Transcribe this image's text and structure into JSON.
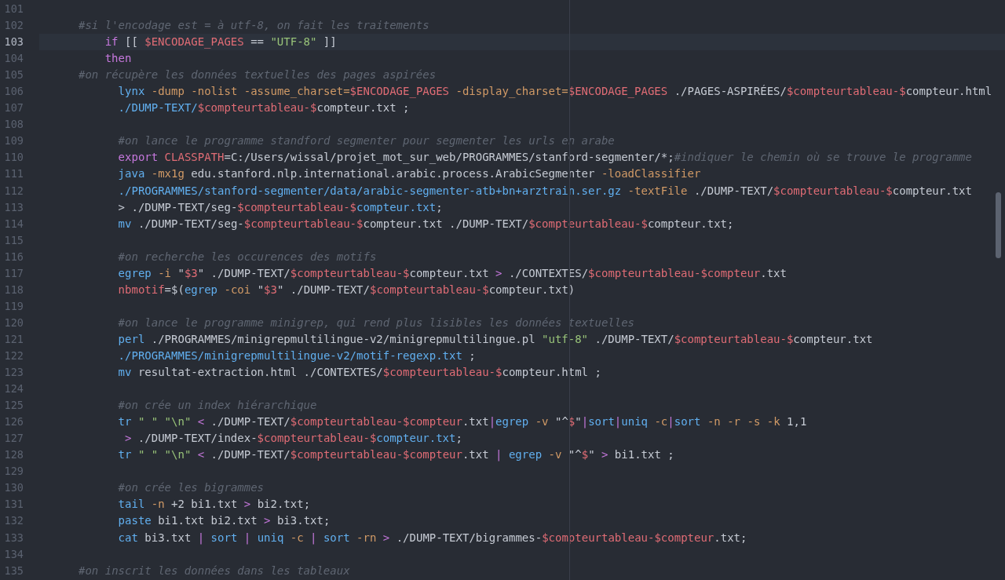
{
  "editor": {
    "lines": [
      {
        "number": "101",
        "current": false,
        "kind": "outer"
      },
      {
        "number": "102",
        "current": false,
        "kind": "outer",
        "tokens": [
          {
            "text": "#si l'encodage est = à utf-8, on fait les traitements",
            "kind": "comment"
          }
        ]
      },
      {
        "number": "103",
        "current": true,
        "kind": "inner",
        "tokens": [
          {
            "text": "if",
            "kind": "keyword"
          },
          {
            "text": " [[ ",
            "kind": "plain"
          },
          {
            "text": "$ENCODAGE_PAGES",
            "kind": "var"
          },
          {
            "text": " == ",
            "kind": "plain"
          },
          {
            "text": "\"UTF-8\"",
            "kind": "string"
          },
          {
            "text": " ]]",
            "kind": "plain"
          }
        ]
      },
      {
        "number": "104",
        "current": false,
        "kind": "inner",
        "tokens": [
          {
            "text": "then",
            "kind": "keyword"
          }
        ]
      },
      {
        "number": "105",
        "current": false,
        "kind": "outer",
        "tokens": [
          {
            "text": "#on récupère les données textuelles des pages aspirées",
            "kind": "comment"
          }
        ]
      },
      {
        "number": "106",
        "current": false,
        "kind": "body",
        "tokens": [
          {
            "text": "lynx",
            "kind": "func"
          },
          {
            "text": " -dump -nolist -assume_charset=",
            "kind": "option"
          },
          {
            "text": "$ENCODAGE_PAGES",
            "kind": "var"
          },
          {
            "text": " -display_charset=",
            "kind": "option"
          },
          {
            "text": "$ENCODAGE_PAGES",
            "kind": "var"
          },
          {
            "text": " ./PAGES-ASPIRÉES/",
            "kind": "plain"
          },
          {
            "text": "$compteurtableau-$",
            "kind": "var"
          },
          {
            "text": "compteur.html",
            "kind": "plain"
          }
        ]
      },
      {
        "number": "107",
        "current": false,
        "kind": "body",
        "tokens": [
          {
            "text": "./DUMP-TEXT/",
            "kind": "func"
          },
          {
            "text": "$compteurtableau-$",
            "kind": "var"
          },
          {
            "text": "compteur.txt ;",
            "kind": "plain"
          }
        ]
      },
      {
        "number": "108",
        "current": false,
        "kind": "outer"
      },
      {
        "number": "109",
        "current": false,
        "kind": "body",
        "tokens": [
          {
            "text": "#on lance le programme standford segmenter pour segmenter les urls en arabe",
            "kind": "comment"
          }
        ]
      },
      {
        "number": "110",
        "current": false,
        "kind": "body",
        "tokens": [
          {
            "text": "export",
            "kind": "keyword"
          },
          {
            "text": " CLASSPATH",
            "kind": "var"
          },
          {
            "text": "=C:/Users/wissal/projet_mot_sur_web/PROGRAMMES/stanford-segmenter/*;",
            "kind": "plain"
          },
          {
            "text": "#indiquer le chemin où se trouve le programme",
            "kind": "comment"
          }
        ]
      },
      {
        "number": "111",
        "current": false,
        "kind": "body",
        "tokens": [
          {
            "text": "java",
            "kind": "func"
          },
          {
            "text": " -mx1g",
            "kind": "option"
          },
          {
            "text": " edu.stanford.nlp.international.arabic.process.ArabicSegmenter ",
            "kind": "plain"
          },
          {
            "text": "-loadClassifier",
            "kind": "option"
          }
        ]
      },
      {
        "number": "112",
        "current": false,
        "kind": "body",
        "tokens": [
          {
            "text": "./PROGRAMMES/stanford-segmenter/data/arabic-segmenter-atb+bn+arztrain.ser.gz",
            "kind": "func"
          },
          {
            "text": " -textFile",
            "kind": "option"
          },
          {
            "text": " ./DUMP-TEXT/",
            "kind": "plain"
          },
          {
            "text": "$compteurtableau-$",
            "kind": "var"
          },
          {
            "text": "compteur.txt",
            "kind": "plain"
          }
        ]
      },
      {
        "number": "113",
        "current": false,
        "kind": "body",
        "tokens": [
          {
            "text": "> ./DUMP-TEXT/seg-",
            "kind": "plain"
          },
          {
            "text": "$compteurtableau-$",
            "kind": "var"
          },
          {
            "text": "compteur.txt",
            "kind": "func"
          },
          {
            "text": ";",
            "kind": "plain"
          }
        ]
      },
      {
        "number": "114",
        "current": false,
        "kind": "body",
        "tokens": [
          {
            "text": "mv",
            "kind": "func"
          },
          {
            "text": " ./DUMP-TEXT/seg-",
            "kind": "plain"
          },
          {
            "text": "$compteurtableau-$",
            "kind": "var"
          },
          {
            "text": "compteur.txt ./DUMP-TEXT/",
            "kind": "plain"
          },
          {
            "text": "$compteurtableau-$",
            "kind": "var"
          },
          {
            "text": "compteur.txt;",
            "kind": "plain"
          }
        ]
      },
      {
        "number": "115",
        "current": false,
        "kind": "outer"
      },
      {
        "number": "116",
        "current": false,
        "kind": "body",
        "tokens": [
          {
            "text": "#on recherche les occurences des motifs",
            "kind": "comment"
          }
        ]
      },
      {
        "number": "117",
        "current": false,
        "kind": "body",
        "tokens": [
          {
            "text": "egrep",
            "kind": "func"
          },
          {
            "text": " -i",
            "kind": "option"
          },
          {
            "text": " \"",
            "kind": "plain"
          },
          {
            "text": "$3",
            "kind": "var"
          },
          {
            "text": "\" ./DUMP-TEXT/",
            "kind": "plain"
          },
          {
            "text": "$compteurtableau-$",
            "kind": "var"
          },
          {
            "text": "compteur.txt ",
            "kind": "plain"
          },
          {
            "text": ">",
            "kind": "operator"
          },
          {
            "text": " ./CONTEXTES/",
            "kind": "plain"
          },
          {
            "text": "$compteurtableau-$compteur",
            "kind": "var"
          },
          {
            "text": ".txt",
            "kind": "plain"
          }
        ]
      },
      {
        "number": "118",
        "current": false,
        "kind": "body",
        "tokens": [
          {
            "text": "nbmotif",
            "kind": "var"
          },
          {
            "text": "=$(",
            "kind": "plain"
          },
          {
            "text": "egrep",
            "kind": "func"
          },
          {
            "text": " -coi",
            "kind": "option"
          },
          {
            "text": " \"",
            "kind": "plain"
          },
          {
            "text": "$3",
            "kind": "var"
          },
          {
            "text": "\" ./DUMP-TEXT/",
            "kind": "plain"
          },
          {
            "text": "$compteurtableau-$",
            "kind": "var"
          },
          {
            "text": "compteur.txt)",
            "kind": "plain"
          }
        ]
      },
      {
        "number": "119",
        "current": false,
        "kind": "outer"
      },
      {
        "number": "120",
        "current": false,
        "kind": "body",
        "tokens": [
          {
            "text": "#on lance le programme minigrep, qui rend plus lisibles les données textuelles",
            "kind": "comment"
          }
        ]
      },
      {
        "number": "121",
        "current": false,
        "kind": "body",
        "tokens": [
          {
            "text": "perl",
            "kind": "func"
          },
          {
            "text": " ./PROGRAMMES/minigrepmultilingue-v2/minigrepmultilingue.pl ",
            "kind": "plain"
          },
          {
            "text": "\"utf-8\"",
            "kind": "string"
          },
          {
            "text": " ./DUMP-TEXT/",
            "kind": "plain"
          },
          {
            "text": "$compteurtableau-$",
            "kind": "var"
          },
          {
            "text": "compteur.txt",
            "kind": "plain"
          }
        ]
      },
      {
        "number": "122",
        "current": false,
        "kind": "body",
        "tokens": [
          {
            "text": "./PROGRAMMES/minigrepmultilingue-v2/motif-regexp.txt",
            "kind": "func"
          },
          {
            "text": " ;",
            "kind": "plain"
          }
        ]
      },
      {
        "number": "123",
        "current": false,
        "kind": "body",
        "tokens": [
          {
            "text": "mv",
            "kind": "func"
          },
          {
            "text": " resultat-extraction.html ./CONTEXTES/",
            "kind": "plain"
          },
          {
            "text": "$compteurtableau-$",
            "kind": "var"
          },
          {
            "text": "compteur.html ;",
            "kind": "plain"
          }
        ]
      },
      {
        "number": "124",
        "current": false,
        "kind": "outer"
      },
      {
        "number": "125",
        "current": false,
        "kind": "body",
        "tokens": [
          {
            "text": "#on crée un index hiérarchique",
            "kind": "comment"
          }
        ]
      },
      {
        "number": "126",
        "current": false,
        "kind": "body",
        "tokens": [
          {
            "text": "tr",
            "kind": "func"
          },
          {
            "text": " \" \"",
            "kind": "string"
          },
          {
            "text": " \"\\n\"",
            "kind": "string"
          },
          {
            "text": " <",
            "kind": "operator"
          },
          {
            "text": " ./DUMP-TEXT/",
            "kind": "plain"
          },
          {
            "text": "$compteurtableau-$compteur",
            "kind": "var"
          },
          {
            "text": ".txt",
            "kind": "plain"
          },
          {
            "text": "|",
            "kind": "operator"
          },
          {
            "text": "egrep",
            "kind": "func"
          },
          {
            "text": " -v",
            "kind": "option"
          },
          {
            "text": " \"^",
            "kind": "plain"
          },
          {
            "text": "$",
            "kind": "var"
          },
          {
            "text": "\"",
            "kind": "plain"
          },
          {
            "text": "|",
            "kind": "operator"
          },
          {
            "text": "sort",
            "kind": "func"
          },
          {
            "text": "|",
            "kind": "operator"
          },
          {
            "text": "uniq",
            "kind": "func"
          },
          {
            "text": " -c",
            "kind": "option"
          },
          {
            "text": "|",
            "kind": "operator"
          },
          {
            "text": "sort",
            "kind": "func"
          },
          {
            "text": " -n -r -s -k",
            "kind": "option"
          },
          {
            "text": " 1,1",
            "kind": "plain"
          }
        ]
      },
      {
        "number": "127",
        "current": false,
        "kind": "wrapped",
        "tokens": [
          {
            "text": ">",
            "kind": "operator"
          },
          {
            "text": " ./DUMP-TEXT/index-",
            "kind": "plain"
          },
          {
            "text": "$compteurtableau-$",
            "kind": "var"
          },
          {
            "text": "compteur.txt",
            "kind": "func"
          },
          {
            "text": ";",
            "kind": "plain"
          }
        ]
      },
      {
        "number": "128",
        "current": false,
        "kind": "body",
        "tokens": [
          {
            "text": "tr",
            "kind": "func"
          },
          {
            "text": " \" \"",
            "kind": "string"
          },
          {
            "text": " \"\\n\"",
            "kind": "string"
          },
          {
            "text": " <",
            "kind": "operator"
          },
          {
            "text": " ./DUMP-TEXT/",
            "kind": "plain"
          },
          {
            "text": "$compteurtableau-$compteur",
            "kind": "var"
          },
          {
            "text": ".txt ",
            "kind": "plain"
          },
          {
            "text": "|",
            "kind": "operator"
          },
          {
            "text": " egrep",
            "kind": "func"
          },
          {
            "text": " -v",
            "kind": "option"
          },
          {
            "text": " \"^",
            "kind": "plain"
          },
          {
            "text": "$",
            "kind": "var"
          },
          {
            "text": "\" ",
            "kind": "plain"
          },
          {
            "text": ">",
            "kind": "operator"
          },
          {
            "text": " bi1.txt ;",
            "kind": "plain"
          }
        ]
      },
      {
        "number": "129",
        "current": false,
        "kind": "outer"
      },
      {
        "number": "130",
        "current": false,
        "kind": "body",
        "tokens": [
          {
            "text": "#on crée les bigrammes",
            "kind": "comment"
          }
        ]
      },
      {
        "number": "131",
        "current": false,
        "kind": "body",
        "tokens": [
          {
            "text": "tail",
            "kind": "func"
          },
          {
            "text": " -n",
            "kind": "option"
          },
          {
            "text": " +2 bi1.txt ",
            "kind": "plain"
          },
          {
            "text": ">",
            "kind": "operator"
          },
          {
            "text": " bi2.txt;",
            "kind": "plain"
          }
        ]
      },
      {
        "number": "132",
        "current": false,
        "kind": "body",
        "tokens": [
          {
            "text": "paste",
            "kind": "func"
          },
          {
            "text": " bi1.txt bi2.txt ",
            "kind": "plain"
          },
          {
            "text": ">",
            "kind": "operator"
          },
          {
            "text": " bi3.txt;",
            "kind": "plain"
          }
        ]
      },
      {
        "number": "133",
        "current": false,
        "kind": "body",
        "tokens": [
          {
            "text": "cat",
            "kind": "func"
          },
          {
            "text": " bi3.txt ",
            "kind": "plain"
          },
          {
            "text": "|",
            "kind": "operator"
          },
          {
            "text": " sort",
            "kind": "func"
          },
          {
            "text": " |",
            "kind": "operator"
          },
          {
            "text": " uniq",
            "kind": "func"
          },
          {
            "text": " -c",
            "kind": "option"
          },
          {
            "text": " |",
            "kind": "operator"
          },
          {
            "text": " sort",
            "kind": "func"
          },
          {
            "text": " -rn",
            "kind": "option"
          },
          {
            "text": " >",
            "kind": "operator"
          },
          {
            "text": " ./DUMP-TEXT/bigrammes-",
            "kind": "plain"
          },
          {
            "text": "$compteurtableau-$compteur",
            "kind": "var"
          },
          {
            "text": ".txt;",
            "kind": "plain"
          }
        ]
      },
      {
        "number": "134",
        "current": false,
        "kind": "outer"
      },
      {
        "number": "135",
        "current": false,
        "kind": "outer",
        "tokens": [
          {
            "text": "#on inscrit les données dans les tableaux",
            "kind": "comment"
          }
        ]
      }
    ]
  }
}
